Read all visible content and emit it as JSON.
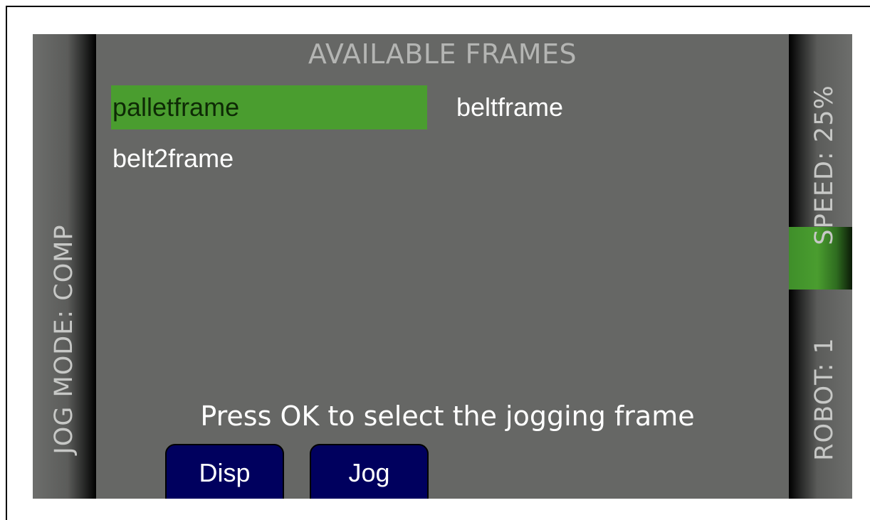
{
  "screen": {
    "title": "AVAILABLE FRAMES",
    "frames": [
      {
        "label": "palletframe",
        "selected": true
      },
      {
        "label": "beltframe",
        "selected": false
      },
      {
        "label": "belt2frame",
        "selected": false
      }
    ],
    "hint": "Press OK to select the jogging frame"
  },
  "left_bar": {
    "jog_mode": "JOG MODE: COMP"
  },
  "right_bar": {
    "speed": "SPEED: 25%",
    "robot": "ROBOT: 1"
  },
  "softkeys": {
    "disp_label": "Disp",
    "jog_label": "Jog"
  },
  "colors": {
    "background": "#666765",
    "selection": "#4a9d2f",
    "softkey": "#00005e",
    "text": "#ffffff",
    "title": "#b4b5b3"
  }
}
